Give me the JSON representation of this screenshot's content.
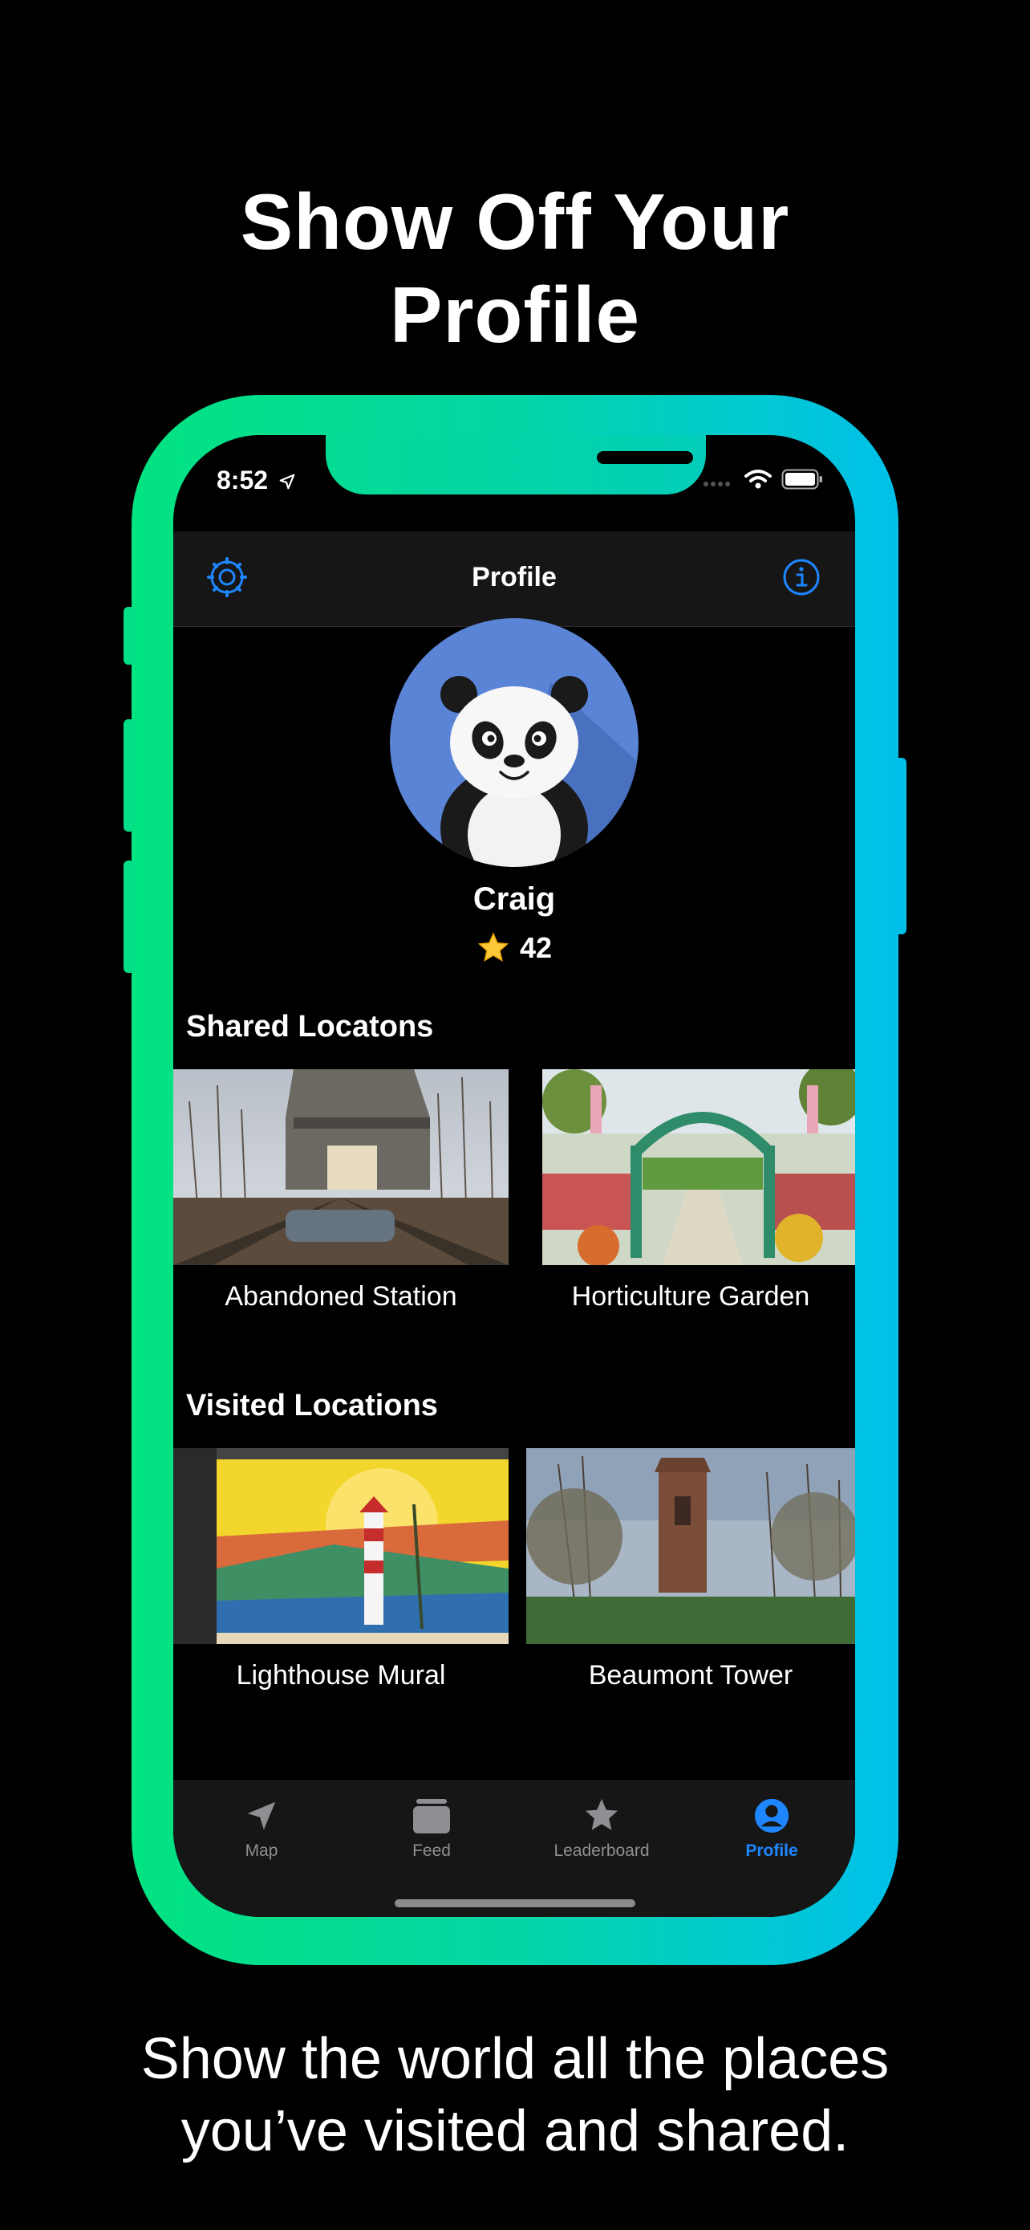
{
  "marketing": {
    "headline_line1": "Show Off Your",
    "headline_line2": "Profile",
    "subtitle_line1": "Show the world all the places",
    "subtitle_line2": "you’ve visited and shared."
  },
  "status_bar": {
    "time": "8:52"
  },
  "nav": {
    "title": "Profile",
    "left_icon": "settings-icon",
    "right_icon": "info-icon"
  },
  "profile": {
    "name": "Craig",
    "score": "42"
  },
  "shared": {
    "title": "Shared Locatons",
    "items": [
      {
        "caption": "Abandoned Station"
      },
      {
        "caption": "Horticulture Garden"
      }
    ]
  },
  "visited": {
    "title": "Visited Locations",
    "items": [
      {
        "caption": "Lighthouse Mural"
      },
      {
        "caption": "Beaumont Tower"
      }
    ]
  },
  "tabs": [
    {
      "label": "Map",
      "icon": "location-arrow-icon"
    },
    {
      "label": "Feed",
      "icon": "feed-icon"
    },
    {
      "label": "Leaderboard",
      "icon": "star-icon"
    },
    {
      "label": "Profile",
      "icon": "person-icon",
      "active": true
    }
  ],
  "colors": {
    "accent": "#1e86ff",
    "inactive": "#8e8e93",
    "gradient_start": "#02e381",
    "gradient_end": "#00c0ea"
  }
}
